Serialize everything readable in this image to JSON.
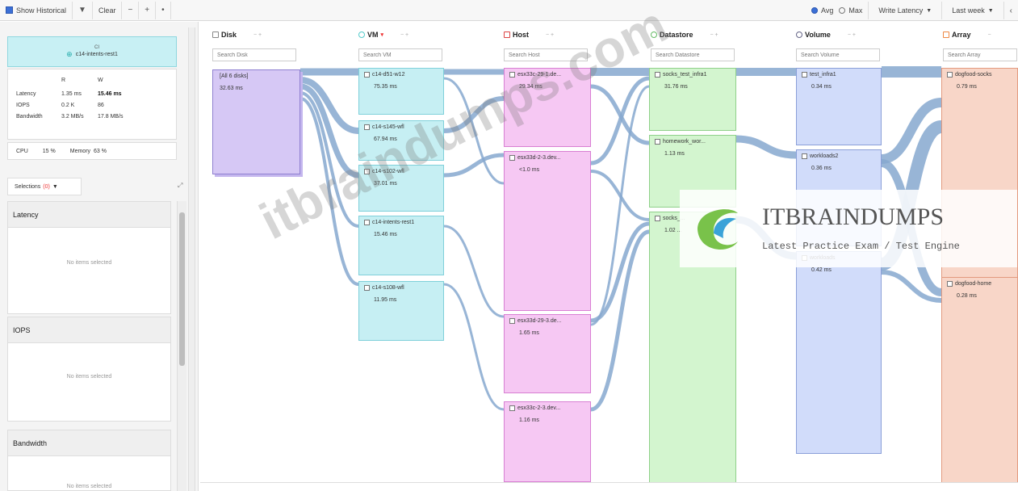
{
  "toolbar": {
    "show_historical": "Show Historical",
    "clear": "Clear",
    "avg": "Avg",
    "max": "Max",
    "metric": "Write Latency",
    "range": "Last week"
  },
  "left": {
    "object_sub": "CI",
    "object_name": "c14-intents-rest1",
    "stats": {
      "head_r": "R",
      "head_w": "W",
      "rows": [
        {
          "label": "Latency",
          "r": "1.35 ms",
          "w": "15.46 ms"
        },
        {
          "label": "IOPS",
          "r": "0.2 K",
          "w": "86"
        },
        {
          "label": "Bandwidth",
          "r": "3.2 MB/s",
          "w": "17.8 MB/s"
        }
      ]
    },
    "cpu_label": "CPU",
    "cpu_value": "15 %",
    "memory_label": "Memory",
    "memory_value": "63 %",
    "selections_label": "Selections",
    "selections_count": "(0)",
    "sections": [
      {
        "title": "Latency",
        "empty": "No items selected"
      },
      {
        "title": "IOPS",
        "empty": "No items selected"
      },
      {
        "title": "Bandwidth",
        "empty": "No items selected"
      }
    ]
  },
  "columns": [
    {
      "title": "Disk",
      "search": "Search Disk"
    },
    {
      "title": "VM",
      "search": "Search VM"
    },
    {
      "title": "Host",
      "search": "Search Host"
    },
    {
      "title": "Datastore",
      "search": "Search Datastore"
    },
    {
      "title": "Volume",
      "search": "Search Volume"
    },
    {
      "title": "Array",
      "search": "Search Array"
    }
  ],
  "column_colors": {
    "disk": "#d6c8f5",
    "vm": "#c6eff3",
    "host": "#f6c8f3",
    "datastore": "#d3f5cf",
    "volume": "#d1dcfa",
    "array": "#f8d6c8",
    "link": "#86a8cf"
  },
  "nodes": {
    "disk": [
      {
        "name": "[All 6 disks]",
        "value": "32.63 ms"
      }
    ],
    "vm": [
      {
        "name": "c14-d51-w12",
        "value": "75.35 ms"
      },
      {
        "name": "c14-s145-wfl",
        "value": "67.94 ms"
      },
      {
        "name": "c14-s102-wfl",
        "value": "37.01 ms"
      },
      {
        "name": "c14-intents-rest1",
        "value": "15.46 ms"
      },
      {
        "name": "c14-s108-wfl",
        "value": "11.95 ms"
      }
    ],
    "host": [
      {
        "name": "esx33c-29-1.de...",
        "value": "29.34 ms"
      },
      {
        "name": "esx33d-2-3.dev...",
        "value": "<1.0 ms"
      },
      {
        "name": "esx33d-29-3.de...",
        "value": "1.65 ms"
      },
      {
        "name": "esx33c-2-3.dev...",
        "value": "1.16 ms"
      }
    ],
    "datastore": [
      {
        "name": "socks_test_infra1",
        "value": "31.76 ms"
      },
      {
        "name": "homework_wor...",
        "value": "1.13 ms"
      },
      {
        "name": "socks_...",
        "value": "1.02 ..."
      }
    ],
    "volume": [
      {
        "name": "test_infra1",
        "value": "0.34 ms"
      },
      {
        "name": "workloads2",
        "value": "0.36 ms"
      },
      {
        "name": "workloads",
        "value": "0.42 ms"
      }
    ],
    "array": [
      {
        "name": "dogfood-socks",
        "value": "0.79 ms"
      },
      {
        "name": "dogfood-home",
        "value": "0.28 ms"
      }
    ]
  },
  "watermark": {
    "diagonal": "itbraindumps.com",
    "brand": "ITBRAINDUMPS",
    "tagline": "Latest Practice Exam / Test Engine"
  }
}
